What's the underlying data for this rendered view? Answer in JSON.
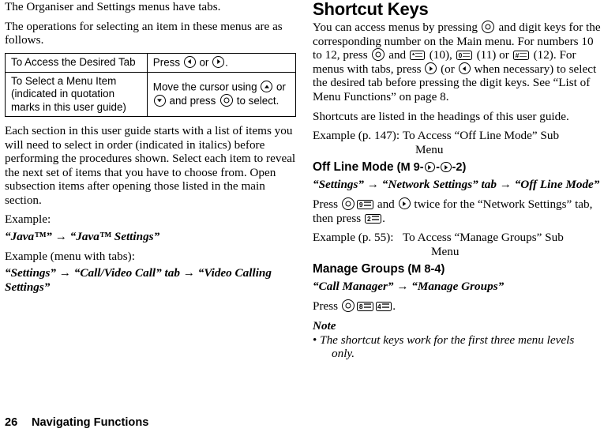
{
  "document": {
    "page_number": "26",
    "footer_title": "Navigating Functions"
  },
  "left_column": {
    "paragraph_1": "The Organiser and Settings menus have tabs.",
    "paragraph_2": "The operations for selecting an item in these menus are as follows.",
    "table": {
      "rows": [
        {
          "action": "To Access the Desired Tab",
          "instruction_pre": "Press ",
          "instruction_mid": " or ",
          "instruction_post": ".",
          "icons": [
            "nav-left-icon",
            "nav-right-icon"
          ]
        },
        {
          "action": "To Select a Menu Item (indicated in quotation marks in this user guide)",
          "instruction_pre": "Move the cursor using ",
          "instruction_mid": " or ",
          "instruction_mid2": " and press ",
          "instruction_post": " to select.",
          "icons": [
            "nav-up-icon",
            "nav-down-icon",
            "centre-select-icon"
          ]
        }
      ]
    },
    "paragraph_3": "Each section in this user guide starts with a list of items you will need to select in order (indicated in italics) before performing the procedures shown. Select each item to reveal the next set of items that you have to choose from. Open subsection items after opening those listed in the main section.",
    "example_label_1": "Example:",
    "example_path_1": "“Java™” → “Java™ Settings”",
    "example_label_2": "Example (menu with tabs):",
    "example_path_2": "“Settings” → “Call/Video Call” tab → “Video Calling Settings”"
  },
  "right_column": {
    "heading": "Shortcut Keys",
    "intro_part1": "You can access menus by pressing ",
    "intro_part2": " and digit keys for the corresponding number on the Main menu. For numbers 10 to 12, press ",
    "intro_part3": " and ",
    "intro_part4": " (10), ",
    "intro_part5": " (11) or ",
    "intro_part6": " (12). For menus with tabs, press ",
    "intro_part7": " (or ",
    "intro_part8": " when necessary) to select the desired tab before pressing the digit keys. See “List of Menu Functions” on page 8.",
    "shortcuts_note": "Shortcuts are listed in the headings of this user guide.",
    "example_1": {
      "label": "Example (p. 147):",
      "line1": "To Access “Off Line Mode” Sub",
      "line2": "Menu"
    },
    "section_1": {
      "heading": "Off Line Mode",
      "shortcut_pre": "(M 9-",
      "shortcut_mid": "-",
      "shortcut_post": "-2)",
      "path": "“Settings” → “Network Settings” tab → “Off Line Mode”",
      "press_part1": "Press ",
      "press_part2": " and ",
      "press_part3": " twice for the “Network Settings” tab, then press ",
      "press_part4": ".",
      "keys": [
        "centre-select-icon",
        "key-9",
        "nav-right-icon",
        "key-2"
      ]
    },
    "example_2": {
      "label": "Example (p. 55):",
      "line1": "To Access “Manage Groups” Sub",
      "line2": "Menu"
    },
    "section_2": {
      "heading": "Manage Groups",
      "shortcut": "(M 8-4)",
      "path": "“Call Manager” → “Manage Groups”",
      "press_part1": "Press ",
      "press_part2": ".",
      "keys": [
        "centre-select-icon",
        "key-8",
        "key-4"
      ]
    },
    "note": {
      "title": "Note",
      "bullet": "•",
      "text_line1": "The shortcut keys work for the first three menu levels",
      "text_line2": "only."
    }
  },
  "key_glyphs": {
    "star_key": "*",
    "zero_key": "0",
    "hash_key": "#",
    "nine_key": "9",
    "two_key": "2",
    "eight_key": "8",
    "four_key": "4"
  }
}
